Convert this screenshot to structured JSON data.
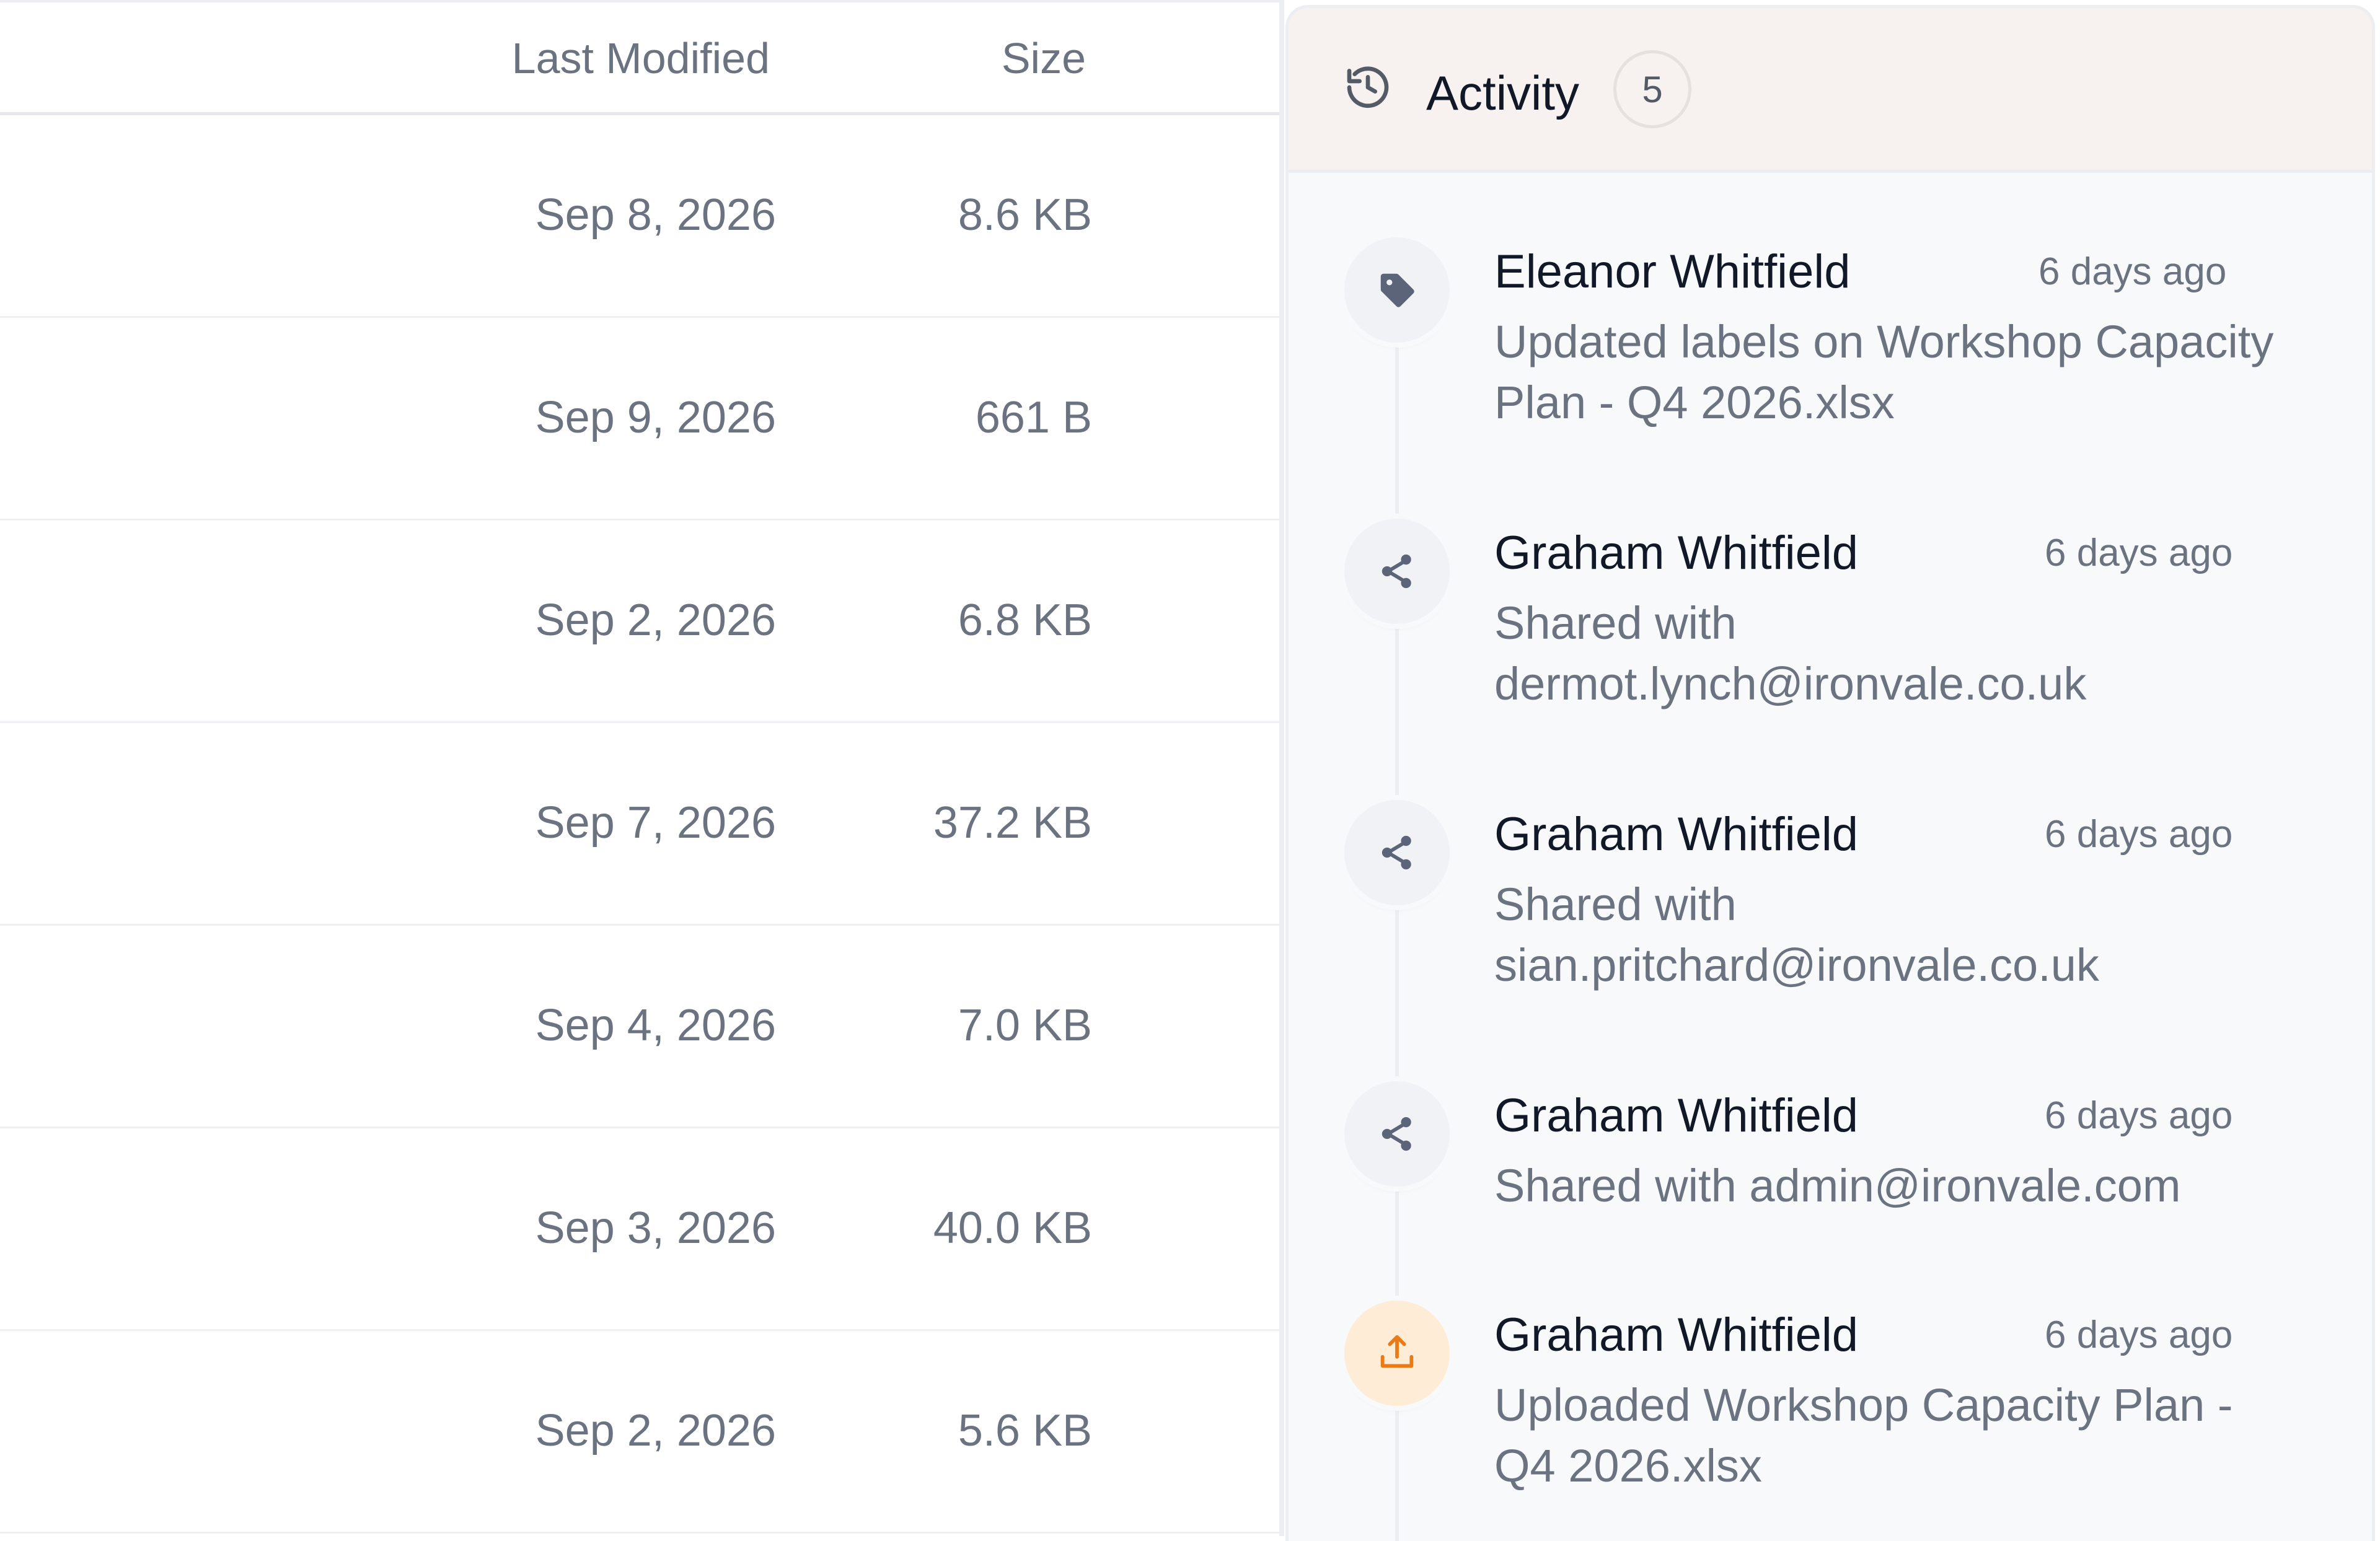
{
  "file_table": {
    "columns": {
      "last_modified": "Last Modified",
      "size": "Size"
    },
    "rows": [
      {
        "modified": "Sep 8, 2026",
        "size": "8.6 KB"
      },
      {
        "modified": "Sep 9, 2026",
        "size": "661 B"
      },
      {
        "modified": "Sep 2, 2026",
        "size": "6.8 KB"
      },
      {
        "modified": "Sep 7, 2026",
        "size": "37.2 KB"
      },
      {
        "modified": "Sep 4, 2026",
        "size": "7.0 KB"
      },
      {
        "modified": "Sep 3, 2026",
        "size": "40.0 KB"
      },
      {
        "modified": "Sep 2, 2026",
        "size": "5.6 KB"
      }
    ]
  },
  "activity_panel": {
    "title": "Activity",
    "count": "5",
    "header_icon": "history-icon",
    "items": [
      {
        "icon": "tag-icon",
        "user": "Eleanor Whitfield",
        "time": "6 days ago",
        "description": "Updated labels on Workshop Capacity Plan - Q4 2026.xlsx"
      },
      {
        "icon": "share-icon",
        "user": "Graham Whitfield",
        "time": "6 days ago",
        "description": "Shared with dermot.lynch@ironvale.co.uk"
      },
      {
        "icon": "share-icon",
        "user": "Graham Whitfield",
        "time": "6 days ago",
        "description": "Shared with sian.pritchard@ironvale.co.uk"
      },
      {
        "icon": "share-icon",
        "user": "Graham Whitfield",
        "time": "6 days ago",
        "description": "Shared with admin@ironvale.com"
      },
      {
        "icon": "upload-icon",
        "user": "Graham Whitfield",
        "time": "6 days ago",
        "description": "Uploaded Workshop Capacity Plan - Q4 2026.xlsx"
      }
    ]
  },
  "colors": {
    "panel_header_bg": "#f7f2f0",
    "panel_bg": "#f8f9fb",
    "icon_slate": "#5b6478",
    "upload_accent": "#ea7a16",
    "upload_bg": "#feecd6"
  }
}
